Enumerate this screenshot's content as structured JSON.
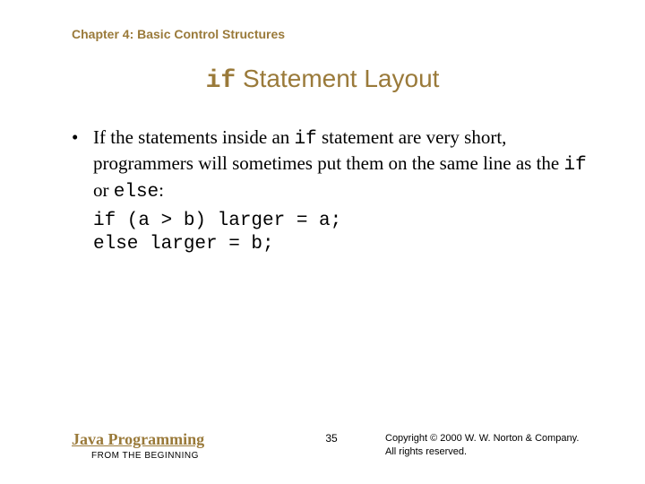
{
  "chapter": "Chapter 4: Basic Control Structures",
  "title": {
    "mono": "if",
    "rest": " Statement Layout"
  },
  "bullet": {
    "p1": "If the statements inside an ",
    "m1": "if",
    "p2": " statement are very short, programmers will sometimes put them on the same line as the ",
    "m2": "if",
    "p3": " or ",
    "m3": "else",
    "p4": ":"
  },
  "code": "if (a > b) larger = a;\nelse larger = b;",
  "footer": {
    "book_main": "Java Programming",
    "book_sub": "FROM THE BEGINNING",
    "page": "35",
    "copyright_l1": "Copyright © 2000 W. W. Norton & Company.",
    "copyright_l2": "All rights reserved."
  }
}
